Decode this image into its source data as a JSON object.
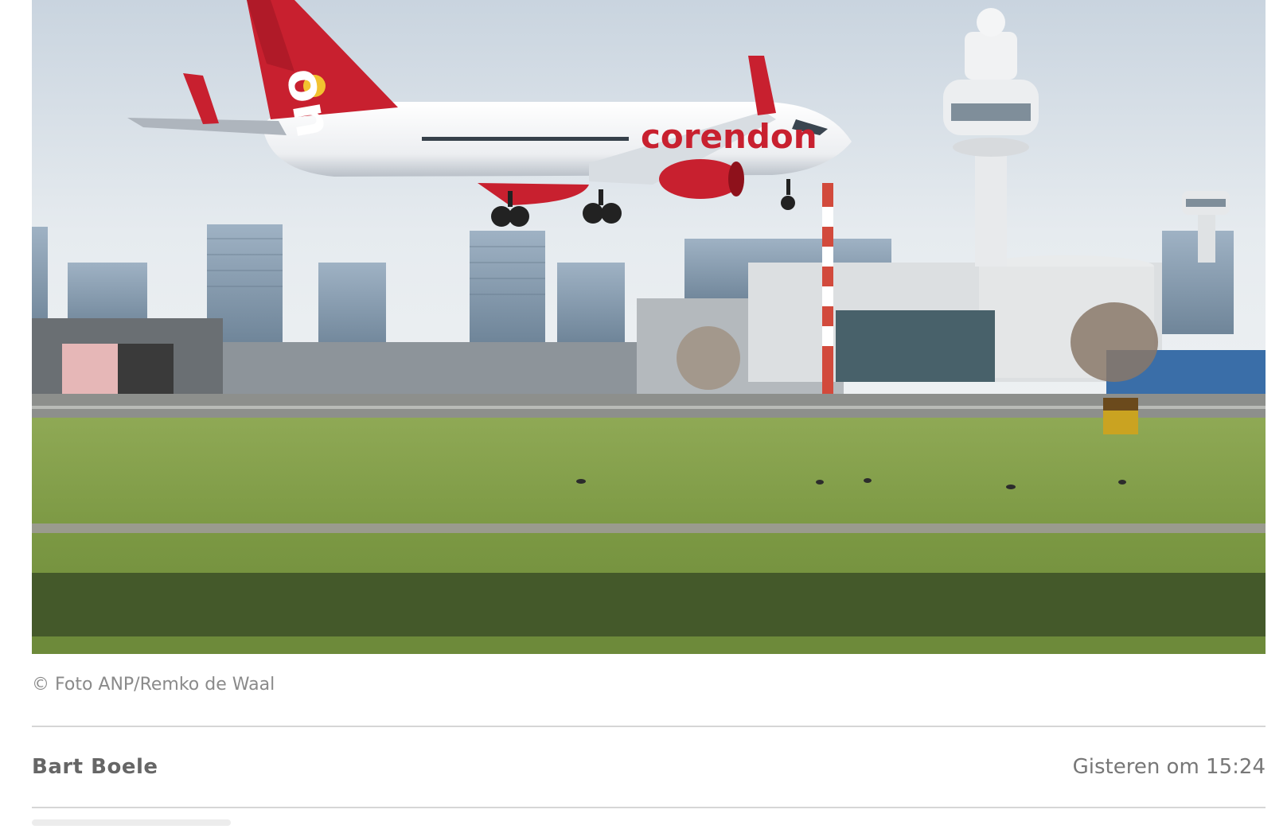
{
  "hero_image": {
    "alt": "",
    "airline_livery": "corendon",
    "tail_text": "on"
  },
  "caption": {
    "credit": "© Foto ANP/Remko de Waal"
  },
  "byline": {
    "author": "Bart Boele",
    "timestamp": "Gisteren om 15:24"
  },
  "colors": {
    "sky": "#d9e2ea",
    "grass": "#7f9a46",
    "livery_red": "#c8202f",
    "divider": "#d6d6d6"
  }
}
